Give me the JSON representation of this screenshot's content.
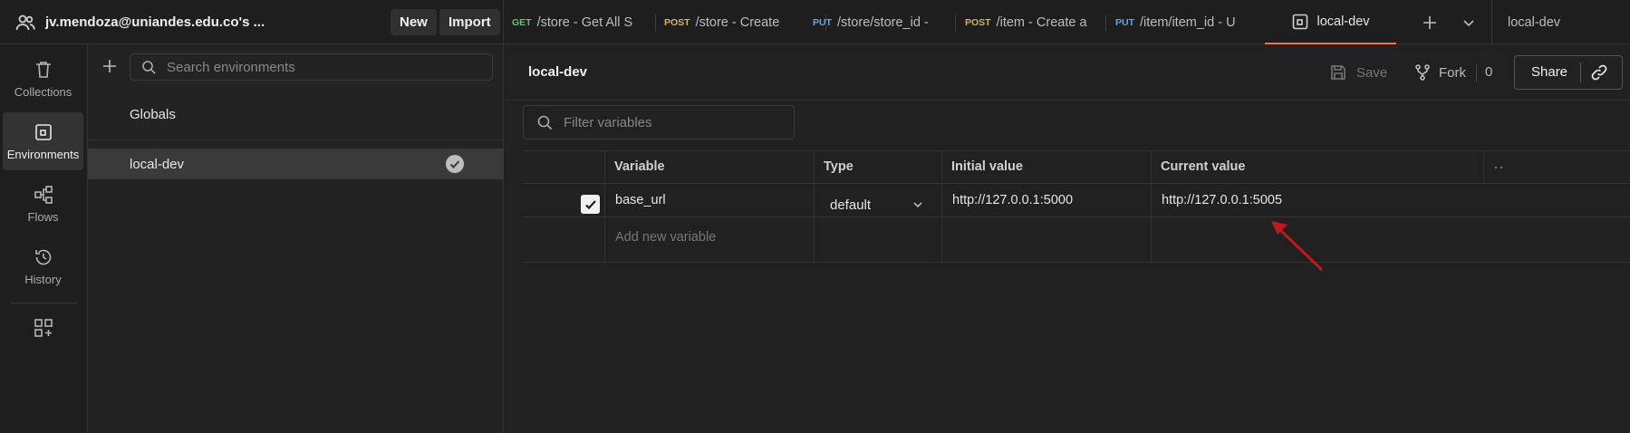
{
  "workspace": {
    "name": "jv.mendoza@uniandes.edu.co's ...",
    "new_label": "New",
    "import_label": "Import"
  },
  "tabs": [
    {
      "method": "GET",
      "label": "/store - Get All S"
    },
    {
      "method": "POST",
      "label": "/store - Create"
    },
    {
      "method": "PUT",
      "label": "/store/store_id -"
    },
    {
      "method": "POST",
      "label": "/item - Create a"
    },
    {
      "method": "PUT",
      "label": "/item/item_id - U"
    }
  ],
  "active_tab": {
    "label": "local-dev"
  },
  "environment_selector": {
    "label": "local-dev"
  },
  "sidebar": {
    "items": [
      {
        "label": "Collections",
        "icon": "trash-bin-icon"
      },
      {
        "label": "Environments",
        "icon": "environment-icon"
      },
      {
        "label": "Flows",
        "icon": "flows-icon"
      },
      {
        "label": "History",
        "icon": "history-icon"
      }
    ]
  },
  "env_panel": {
    "search_placeholder": "Search environments",
    "globals_label": "Globals",
    "environments": [
      {
        "label": "local-dev",
        "active": true
      }
    ]
  },
  "main": {
    "title": "local-dev",
    "save_label": "Save",
    "fork_label": "Fork",
    "fork_count": "0",
    "share_label": "Share",
    "filter_placeholder": "Filter variables",
    "columns": {
      "variable": "Variable",
      "type": "Type",
      "initial": "Initial value",
      "current": "Current value"
    },
    "rows": [
      {
        "enabled": true,
        "variable": "base_url",
        "type": "default",
        "initial": "http://127.0.0.1:5000",
        "current": "http://127.0.0.1:5005"
      }
    ],
    "add_placeholder": "Add new variable"
  },
  "annotation": {
    "color": "#c0181c"
  }
}
